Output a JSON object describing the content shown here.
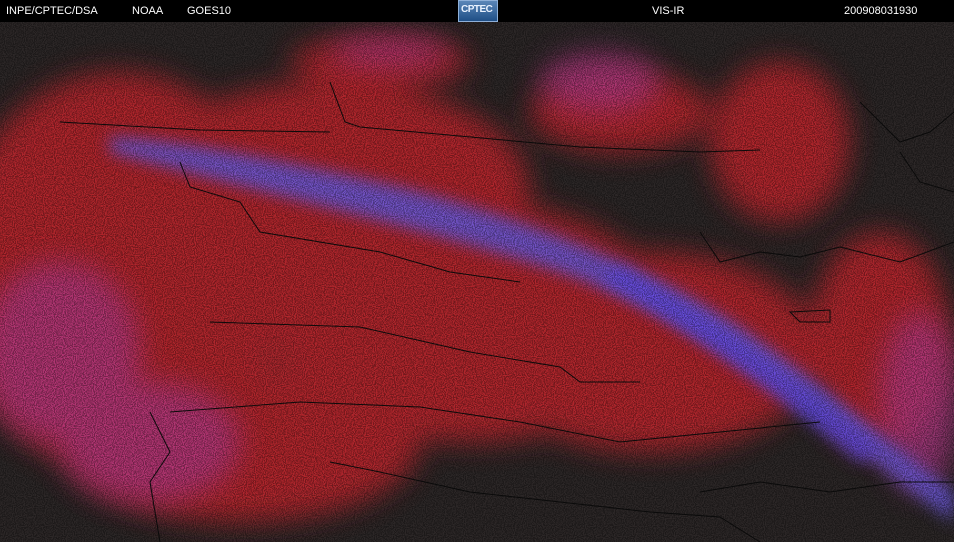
{
  "header": {
    "source": "INPE/CPTEC/DSA",
    "agency": "NOAA",
    "satellite": "GOES10",
    "logo_text": "CPTEC",
    "channel": "VIS-IR",
    "timestamp": "200908031930"
  },
  "colors": {
    "background": "#2c2727",
    "cloud_red": "#c8262e",
    "cloud_magenta": "#b23a8a",
    "cloud_violet": "#6a58d8",
    "boundary": "#0a0a0a"
  }
}
